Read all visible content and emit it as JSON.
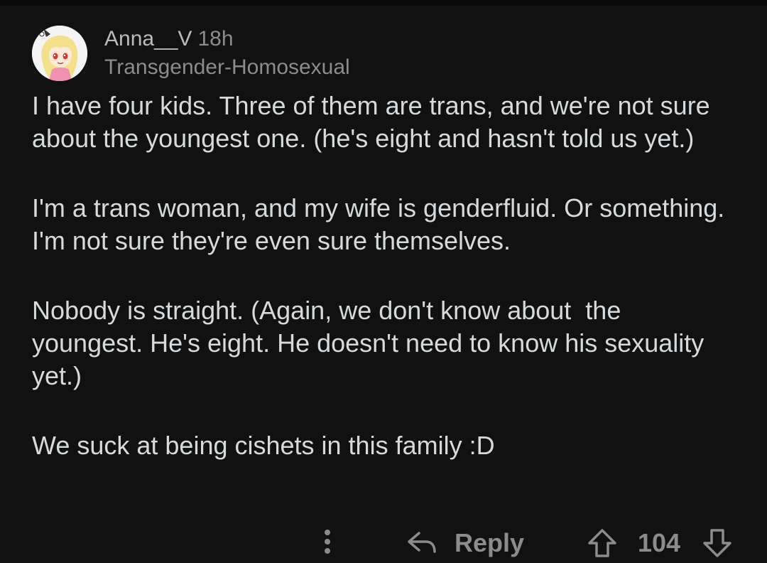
{
  "comment": {
    "author": {
      "username": "Anna__V",
      "timestamp": "18h",
      "flair": "Transgender-Homosexual",
      "avatar_icon": "anime-avatar-icon"
    },
    "paragraphs": [
      "I have four kids. Three of them are trans, and we're not sure about the youngest one. (he's eight and hasn't told us yet.)",
      "I'm a trans woman, and my wife is genderfluid. Or something. I'm not sure they're even sure themselves.",
      "Nobody is straight. (Again, we don't know about  the youngest. He's eight. He doesn't need to know his sexuality yet.)",
      "We suck at being cishets in this family :D"
    ],
    "actions": {
      "more_icon": "more-vertical-icon",
      "reply_icon": "reply-arrow-icon",
      "reply_label": "Reply",
      "upvote_icon": "upvote-arrow-icon",
      "vote_count": "104",
      "downvote_icon": "downvote-arrow-icon"
    }
  },
  "colors": {
    "background": "#111111",
    "text": "#d7dadc",
    "muted": "#8a8c8e"
  }
}
